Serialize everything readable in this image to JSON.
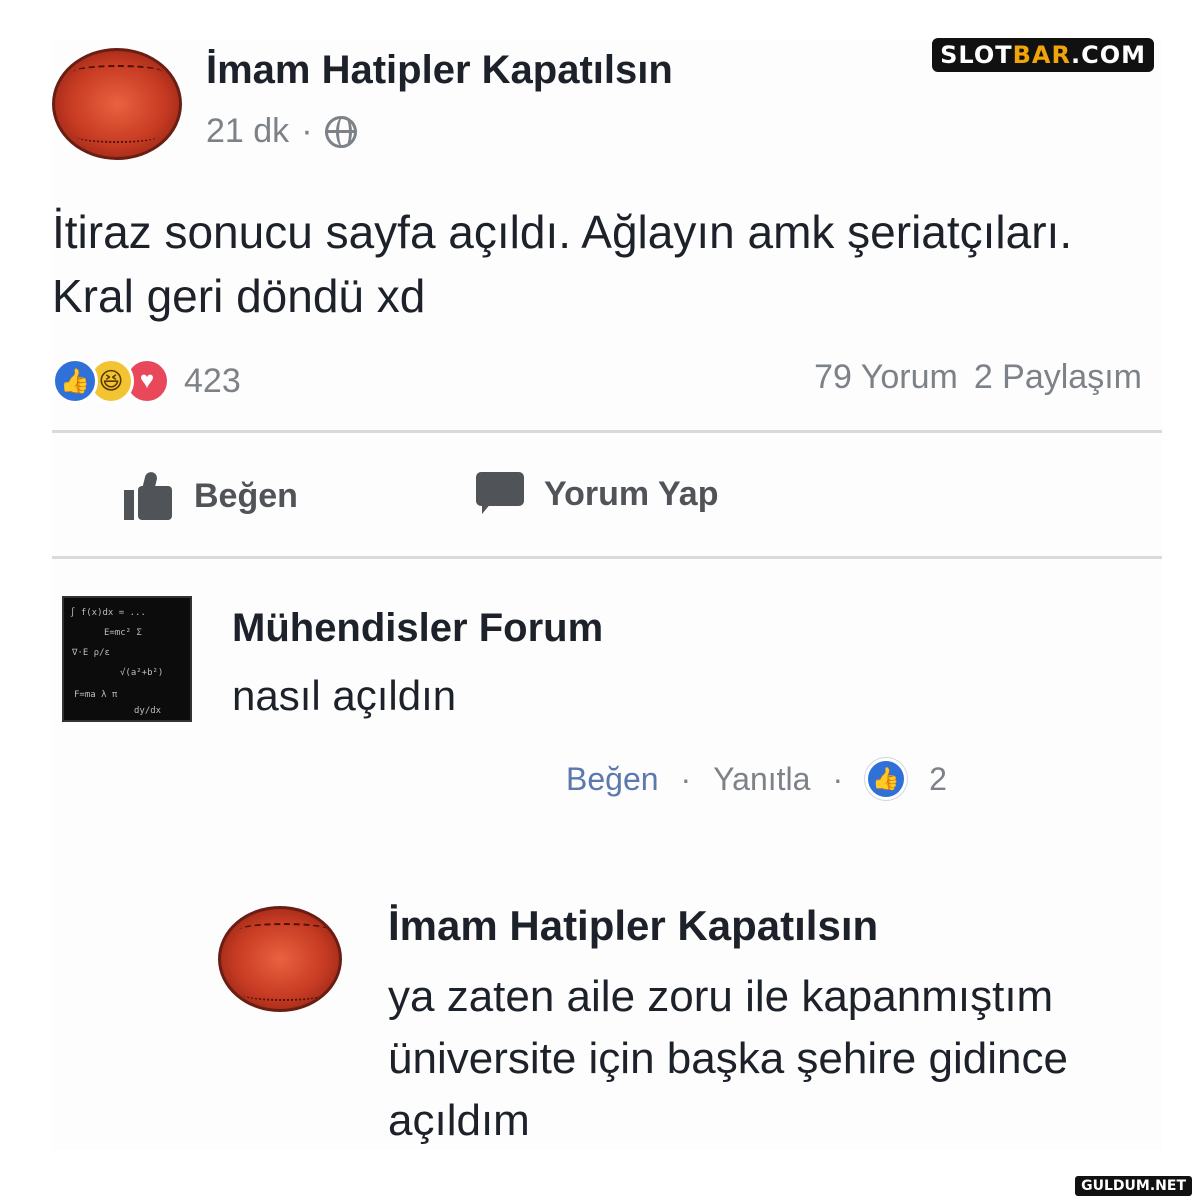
{
  "post": {
    "author": "İmam Hatipler Kapatılsın",
    "time": "21 dk",
    "separator": "·",
    "text": "İtiraz sonucu sayfa açıldı. Ağlayın amk şeriatçıları. Kral geri döndü xd",
    "reaction_count": "423",
    "comments": "79 Yorum",
    "shares": "2 Paylaşım",
    "like_action": "Beğen",
    "comment_action": "Yorum Yap"
  },
  "comment": {
    "author": "Mühendisler Forum",
    "text": "nasıl açıldın",
    "like_link": "Beğen",
    "reply_link": "Yanıtla",
    "dot": "·",
    "like_count": "2"
  },
  "reply": {
    "author": "İmam Hatipler Kapatılsın",
    "text": "ya zaten aile zoru ile kapanmıştım üniversite için başka şehire gidince açıldım"
  },
  "watermarks": {
    "top_prefix": "SLOT",
    "top_accent": "BAR",
    "top_suffix": ".COM",
    "bottom": "GULDUM.NET"
  },
  "colors": {
    "like_blue": "#2f71d8",
    "haha_yellow": "#f3c432",
    "love_red": "#e8485a",
    "link_blue": "#5b79ad",
    "meta_gray": "#7d8288"
  },
  "icons": [
    "globe-icon",
    "like-reaction-icon",
    "haha-reaction-icon",
    "love-reaction-icon",
    "thumbs-up-icon",
    "comment-bubble-icon"
  ]
}
